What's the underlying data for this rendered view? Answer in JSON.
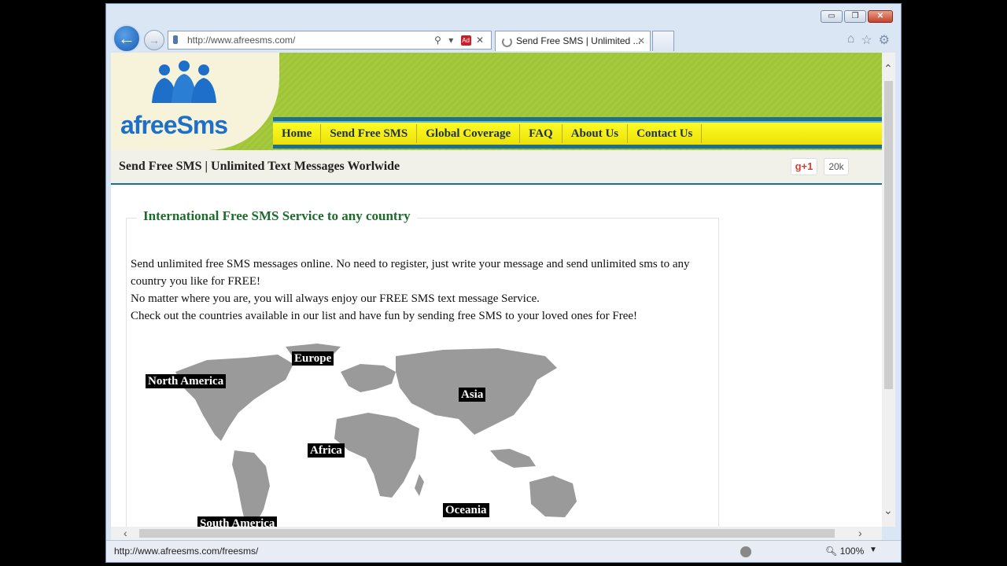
{
  "browser": {
    "window_buttons": [
      "▭",
      "❐",
      "✕"
    ],
    "back_glyph": "←",
    "forward_glyph": "→",
    "address_url": "http://www.afreesms.com/",
    "address_controls": "⚲ ▾",
    "address_addon_badge": "Ad",
    "address_stop": "✕",
    "tab_title": "Send Free SMS | Unlimited ...",
    "tab_close": "✕",
    "tools": [
      "⌂",
      "☆",
      "⚙"
    ],
    "status_url": "http://www.afreesms.com/freesms/",
    "zoom": "100%",
    "zoom_dropdown": "▼"
  },
  "site": {
    "logo_text": "afreeSms",
    "nav": [
      "Home",
      "Send Free SMS",
      "Global Coverage",
      "FAQ",
      "About Us",
      "Contact Us"
    ],
    "page_title": "Send Free SMS | Unlimited Text Messages Worlwide",
    "gplus_label": "g+1",
    "gplus_count": "20k"
  },
  "main": {
    "section_heading": "International Free SMS Service to any country",
    "paragraphs": [
      "Send unlimited free SMS messages online. No need to register, just write your message and send unlimited sms to any country you like for FREE!",
      "No matter where you are, you will always enjoy our FREE SMS text message Service.",
      "Check out the countries available in our list and have fun by sending free SMS to your loved ones for Free!"
    ],
    "map_regions": [
      "Europe",
      "North America",
      "Asia",
      "Africa",
      "Oceania",
      "South America"
    ]
  },
  "colors": {
    "header_green": "#a6ca3e",
    "nav_yellow": "#fdfb24",
    "nav_border_blue": "#1f6e8c",
    "heading_green": "#1c6b2b",
    "logo_blue": "#1d6fc9",
    "map_gray": "#9a9a9a"
  }
}
